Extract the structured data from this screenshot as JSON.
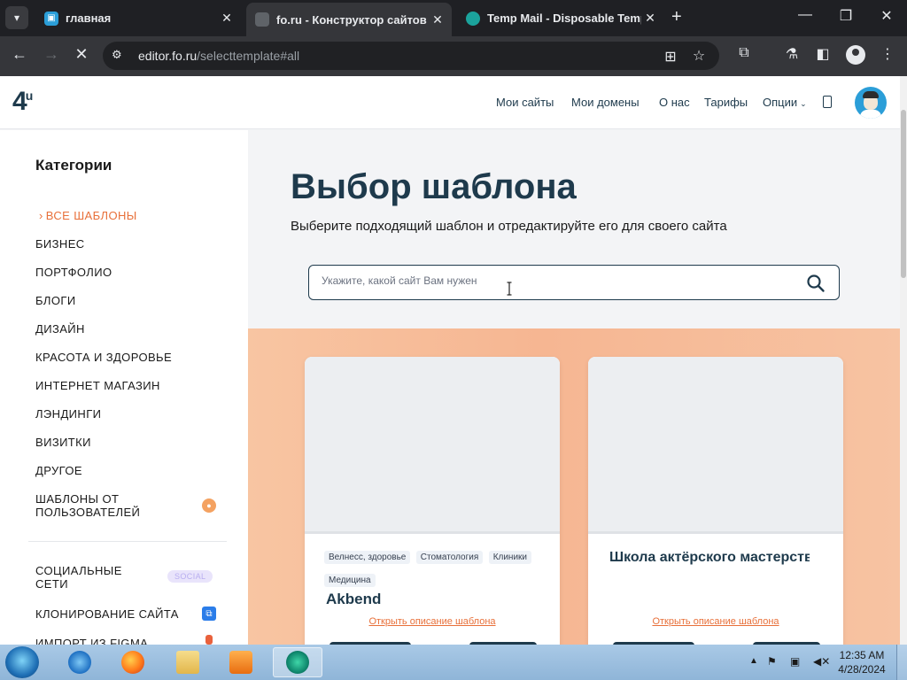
{
  "browser": {
    "tabs": [
      {
        "title": "главная",
        "favicon": "site-favicon",
        "active": false
      },
      {
        "title": "fo.ru - Конструктор сайтов - s",
        "favicon": "fo-favicon",
        "active": true
      },
      {
        "title": "Temp Mail - Disposable Tempo",
        "favicon": "tempmail-favicon",
        "active": false
      }
    ],
    "tab_close": "✕",
    "new_tab": "+",
    "url_host": "editor.fo.ru",
    "url_path": "/selecttemplate#all"
  },
  "header": {
    "logo": "4",
    "logo_sup": "u",
    "nav": [
      "Мои сайты",
      "Мои домены",
      "О нас",
      "Тарифы",
      "Опции"
    ]
  },
  "sidebar": {
    "title": "Категории",
    "categories": [
      "ВСЕ ШАБЛОНЫ",
      "БИЗНЕС",
      "ПОРТФОЛИО",
      "БЛОГИ",
      "ДИЗАЙН",
      "КРАСОТА И ЗДОРОВЬЕ",
      "ИНТЕРНЕТ МАГАЗИН",
      "ЛЭНДИНГИ",
      "ВИЗИТКИ",
      "ДРУГОЕ",
      "ШАБЛОНЫ ОТ",
      "ПОЛЬЗОВАТЕЛЕЙ"
    ],
    "extra": [
      "СОЦИАЛЬНЫЕ",
      "СЕТИ",
      "КЛОНИРОВАНИЕ САЙТА",
      "ИМПОРТ ИЗ FIGMA"
    ],
    "social_badge": "SOCIAL"
  },
  "main": {
    "title": "Выбор шаблона",
    "subtitle": "Выберите подходящий шаблон и отредактируйте его для своего сайта",
    "search_placeholder": "Укажите, какой сайт Вам нужен"
  },
  "cards": [
    {
      "name": "Akbend",
      "tags": [
        "Велнесс, здоровье",
        "Стоматология",
        "Клиники",
        "Медицина"
      ],
      "link": "Открыть описание шаблона"
    },
    {
      "name": "Школа актёрского мастерства",
      "tags": [],
      "link": "Открыть описание шаблона"
    }
  ],
  "taskbar": {
    "time": "12:35 AM",
    "date": "4/28/2024"
  },
  "colors": {
    "accent": "#e8703a",
    "brand_dark": "#1e3a4c",
    "peach": "#f6b692"
  }
}
